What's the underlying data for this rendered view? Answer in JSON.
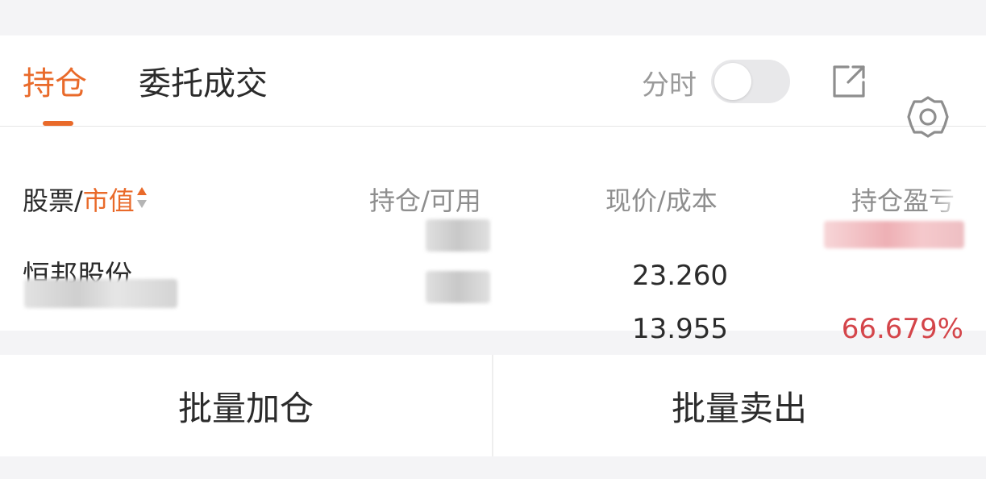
{
  "tabs": {
    "positions": "持仓",
    "orders": "委托成交"
  },
  "toolbar": {
    "timeshare_label": "分时",
    "timeshare_on": false
  },
  "columns": {
    "stock": "股票",
    "separator": "/",
    "market_value": "市值",
    "position_available": "持仓/可用",
    "price_cost": "现价/成本",
    "pnl": "持仓盈亏"
  },
  "holding": {
    "name": "恒邦股份",
    "current_price": "23.260",
    "cost_price": "13.955",
    "pnl_percent": "66.679%"
  },
  "actions": {
    "batch_add": "批量加仓",
    "batch_sell": "批量卖出"
  },
  "colors": {
    "accent": "#e96a2a",
    "profit": "#d4454a"
  }
}
